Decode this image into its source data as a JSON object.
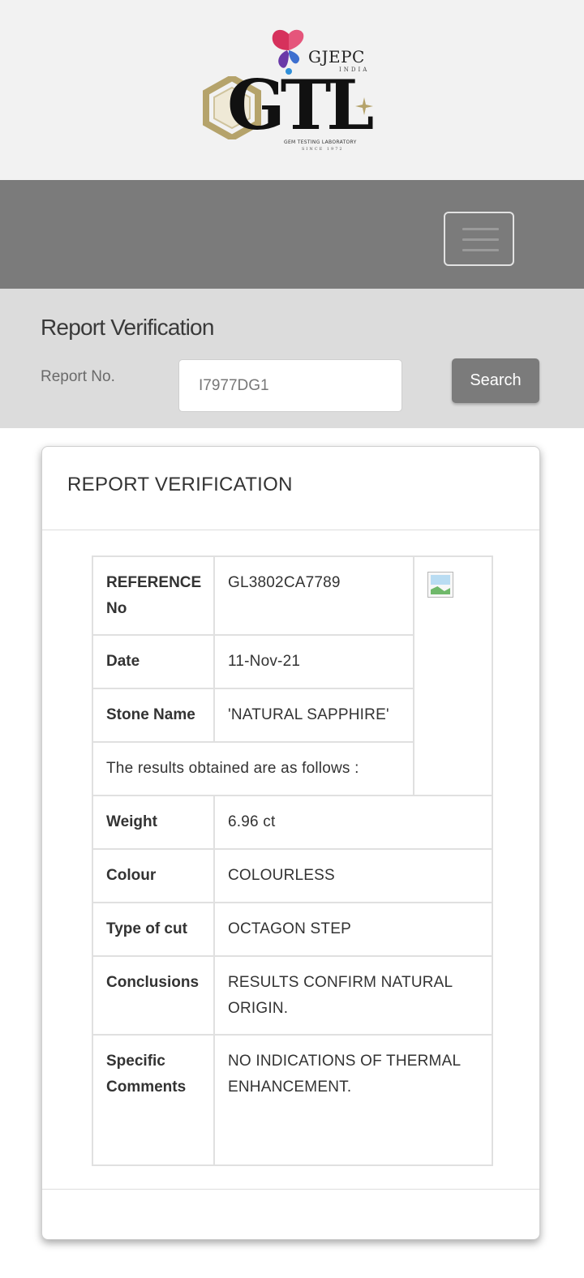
{
  "brand": {
    "gjepc_name": "GJEPC",
    "gjepc_sub": "INDIA",
    "gtl_name": "GTL",
    "tagline": "GEM TESTING LABORATORY",
    "since": "SINCE 1972",
    "colors": {
      "gold": "#b5a36b",
      "dark": "#111111"
    }
  },
  "navbar": {
    "menu_icon": "hamburger-icon",
    "color": "#7b7b7b"
  },
  "search": {
    "title": "Report Verification",
    "field_label": "Report No.",
    "report_value": "I7977DG1",
    "button_label": "Search"
  },
  "card": {
    "title": "REPORT VERIFICATION",
    "rows": {
      "reference": {
        "key": "REFERENCE No",
        "value": "GL3802CA7789"
      },
      "date": {
        "key": "Date",
        "value": "11-Nov-21"
      },
      "stone": {
        "key": "Stone Name",
        "value": "'NATURAL SAPPHIRE'"
      },
      "results_note": "The results obtained are as follows :",
      "weight": {
        "key": "Weight",
        "value": "6.96 ct"
      },
      "colour": {
        "key": "Colour",
        "value": "COLOURLESS"
      },
      "cut": {
        "key": "Type of cut",
        "value": "OCTAGON STEP"
      },
      "conclusions": {
        "key": "Conclusions",
        "value": "RESULTS CONFIRM NATURAL ORIGIN."
      },
      "comments": {
        "key": "Specific Comments",
        "value": "NO INDICATIONS OF THERMAL ENHANCEMENT."
      }
    },
    "image_icon": "broken-image-icon"
  }
}
